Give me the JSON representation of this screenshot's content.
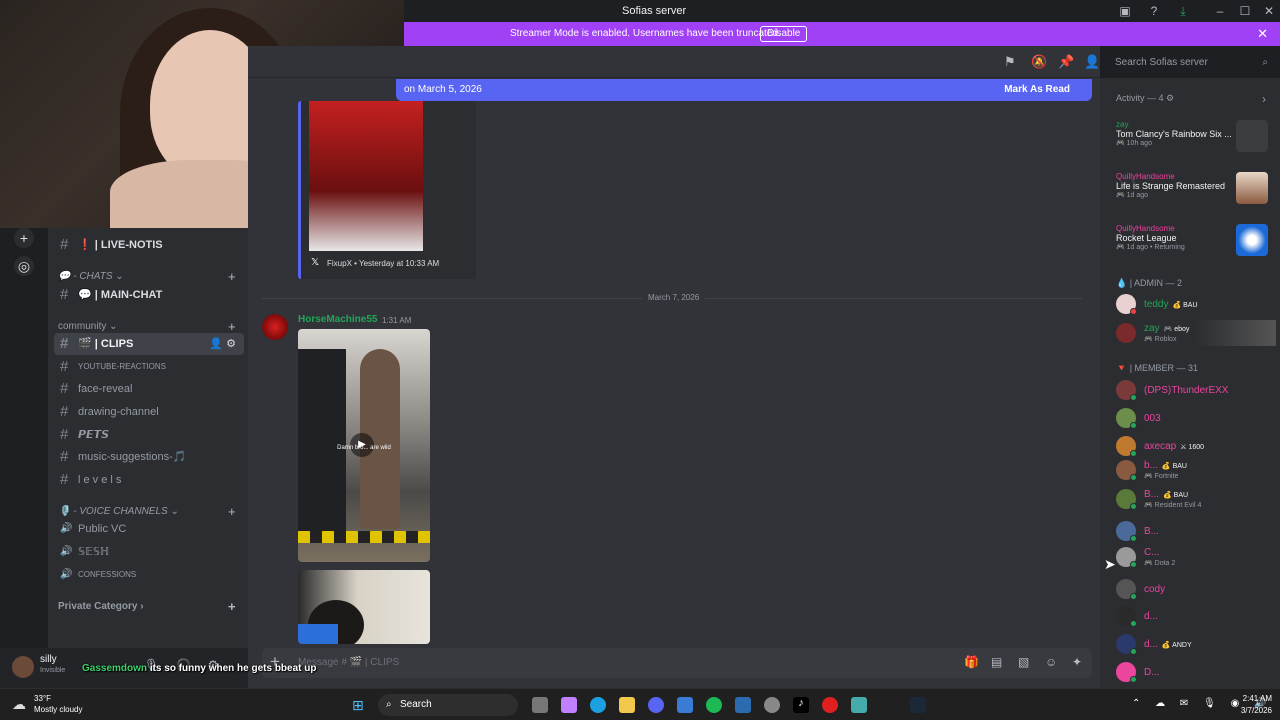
{
  "window": {
    "title": "Sofias server"
  },
  "banner": {
    "message": "Streamer Mode is enabled. Usernames have been truncated.",
    "disable_label": "Disable"
  },
  "new_messages": {
    "date_text": "on March 5, 2026",
    "mark_read": "Mark As Read"
  },
  "search": {
    "placeholder": "Search Sofias server"
  },
  "sidebar": {
    "live_notis": "❗ | LIVE-NOTIS",
    "chats_category": "💬 - CHATS ⌄",
    "main_chat": "💬 | MAIN-CHAT",
    "community_category": "community ⌄",
    "clips": "🎬 | CLIPS",
    "youtube": "YOUTUBE-REACTIONS",
    "face_reveal": "face-reveal",
    "drawing": "drawing-channel",
    "pets": "𝙋𝙀𝙏𝙎",
    "music": "music-suggestions-🎵",
    "levels": "l e v e l s",
    "voice_category": "🎙️ - VOICE CHANNELS ⌄",
    "public_vc": "Public VC",
    "sesh": "𝕊𝔼𝕊ℍ",
    "confessions": "CONFESSIONS",
    "private_category": "Private Category ›"
  },
  "embed": {
    "author": "FixupX • Yesterday at 10:33 AM"
  },
  "divider": {
    "date": "March 7, 2026"
  },
  "message": {
    "username": "HorseMachine55",
    "time": "1:31 AM",
    "video_caption": "Damn bro... are wild"
  },
  "composer": {
    "placeholder": "Message # 🎬 | CLIPS"
  },
  "user_panel": {
    "name": "silly",
    "status": "Invisible"
  },
  "chat_overlay": {
    "name": "Gassemdown",
    "text": "its so funny when he gets bbeat up"
  },
  "members": {
    "activity_header": "Activity — 4 ⚙",
    "activities": [
      {
        "user": "zay",
        "game": "Tom Clancy's Rainbow Six ...",
        "sub": "🎮 10h ago"
      },
      {
        "user": "QuillyHandsome",
        "game": "Life is Strange Remastered",
        "sub": "🎮 1d ago"
      },
      {
        "user": "QuillyHandsome",
        "game": "Rocket League",
        "sub": "🎮 1d ago • Returning"
      }
    ],
    "admin_header": "💧 | ADMIN — 2",
    "admins": [
      {
        "name": "teddy",
        "tag": "💰 BAU",
        "sub": ""
      },
      {
        "name": "zay",
        "tag": "🎮 eboy",
        "sub": "🎮 Roblox"
      }
    ],
    "member_header": "🔻 | MEMBER — 31",
    "members": [
      {
        "name": "(DPS)ThunderEXX",
        "tag": "",
        "sub": ""
      },
      {
        "name": "003",
        "tag": "",
        "sub": ""
      },
      {
        "name": "axecap",
        "tag": "⚔ 1600",
        "sub": ""
      },
      {
        "name": "b...",
        "tag": "💰 BAU",
        "sub": "🎮 Fortnite"
      },
      {
        "name": "B...",
        "tag": "💰 BAU",
        "sub": "🎮 Resident Evil 4"
      },
      {
        "name": "B...",
        "tag": "",
        "sub": ""
      },
      {
        "name": "C...",
        "tag": "",
        "sub": "🎮 Dota 2"
      },
      {
        "name": "cody",
        "tag": "",
        "sub": ""
      },
      {
        "name": "d...",
        "tag": "",
        "sub": ""
      },
      {
        "name": "d...",
        "tag": "💰 ANDY",
        "sub": ""
      },
      {
        "name": "D...",
        "tag": "",
        "sub": ""
      }
    ]
  },
  "taskbar": {
    "weather_temp": "33°F",
    "weather_desc": "Mostly cloudy",
    "search": "Search",
    "time": "2:41 AM",
    "date": "3/7/2026"
  }
}
